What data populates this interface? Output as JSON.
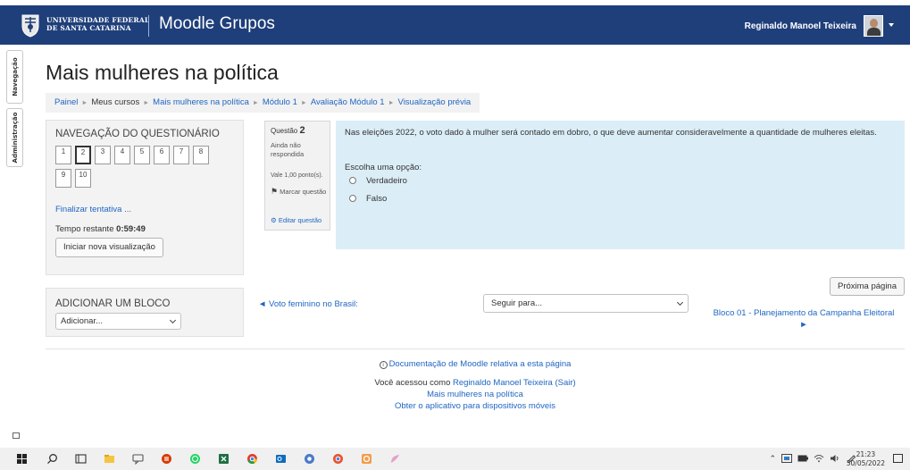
{
  "header": {
    "university": "UNIVERSIDADE FEDERAL\nDE SANTA CATARINA",
    "brand": "Moodle Grupos",
    "user_name": "Reginaldo Manoel Teixeira"
  },
  "side_tabs": [
    "Navegação",
    "Administração"
  ],
  "page_title": "Mais mulheres na política",
  "breadcrumb": [
    "Painel",
    "Meus cursos",
    "Mais mulheres na política",
    "Módulo 1",
    "Avaliação Módulo 1",
    "Visualização prévia"
  ],
  "quiz_nav": {
    "title": "NAVEGAÇÃO DO QUESTIONÁRIO",
    "buttons": [
      "1",
      "2",
      "3",
      "4",
      "5",
      "6",
      "7",
      "8",
      "9",
      "10"
    ],
    "current": "2",
    "finish": "Finalizar tentativa ...",
    "time_label": "Tempo restante ",
    "time_value": "0:59:49",
    "new_preview": "Iniciar nova visualização"
  },
  "add_block": {
    "title": "ADICIONAR UM BLOCO",
    "select_value": "Adicionar..."
  },
  "question": {
    "label": "Questão",
    "number": "2",
    "status": "Ainda não respondida",
    "grade": "Vale 1,00 ponto(s).",
    "flag": "Marcar questão",
    "edit": "Editar questão",
    "text": "Nas eleições 2022, o voto dado à mulher será contado em dobro, o que deve aumentar consideravelmente a quantidade de mulheres eleitas.",
    "prompt": "Escolha uma opção:",
    "options": [
      "Verdadeiro",
      "Falso"
    ]
  },
  "navigation": {
    "next_page": "Próxima página",
    "prev_link": "◄ Voto feminino no Brasil:",
    "jump_select": "Seguir para...",
    "next_link": "Bloco 01 - Planejamento da Campanha Eleitoral",
    "next_arrow": "►"
  },
  "footer": {
    "doc_link": "Documentação de Moodle relativa a esta página",
    "logged_prefix": "Você acessou como ",
    "logged_user": "Reginaldo Manoel Teixeira",
    "logout": "(Sair)",
    "course_link": "Mais mulheres na política",
    "app_link": "Obter o aplicativo para dispositivos móveis"
  },
  "taskbar": {
    "time": "21:23",
    "date": "30/05/2022"
  },
  "colors": {
    "navbar": "#1f3f7a",
    "link": "#1f66c2",
    "question_bg": "#dbeef7"
  }
}
